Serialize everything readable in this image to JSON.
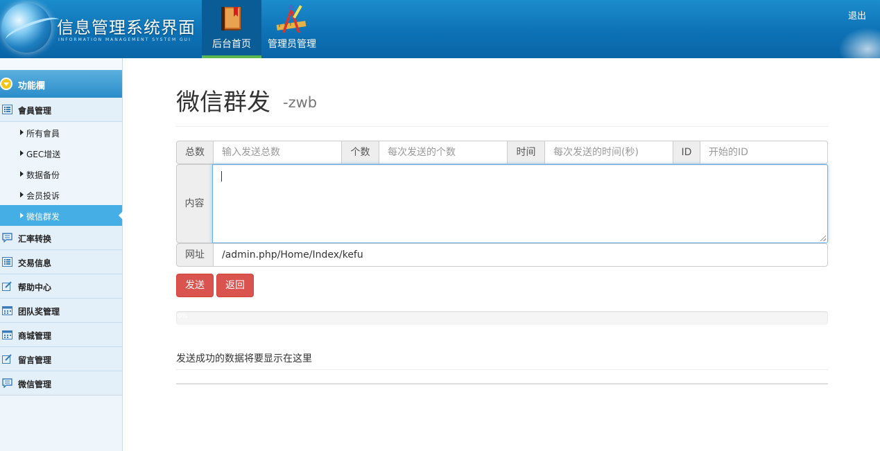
{
  "header": {
    "title": "信息管理系统界面",
    "subtitle": "INFORMATION MANAGEMENT SYSTEM GUI",
    "nav": [
      {
        "label": "后台首页",
        "icon": "book-icon"
      },
      {
        "label": "管理员管理",
        "icon": "tools-icon"
      }
    ],
    "logout": "退出"
  },
  "sidebar": {
    "heading": "功能欄",
    "groups": [
      {
        "label": "會員管理",
        "icon": "list-icon"
      },
      {
        "label": "汇率转换",
        "icon": "chat-icon"
      },
      {
        "label": "交易信息",
        "icon": "list-icon"
      },
      {
        "label": "帮助中心",
        "icon": "edit-icon"
      },
      {
        "label": "团队奖管理",
        "icon": "calendar-icon"
      },
      {
        "label": "商城管理",
        "icon": "calendar-icon"
      },
      {
        "label": "留言管理",
        "icon": "edit-icon"
      },
      {
        "label": "微信管理",
        "icon": "chat-icon"
      }
    ],
    "sub_items": [
      {
        "label": "所有會員"
      },
      {
        "label": "GEC增送"
      },
      {
        "label": "数据备份"
      },
      {
        "label": "会员投诉"
      },
      {
        "label": "微信群发",
        "active": true
      }
    ]
  },
  "main": {
    "title": "微信群发",
    "subtitle": "-zwb",
    "fields": {
      "total": {
        "label": "总数",
        "placeholder": "输入发送总数"
      },
      "count": {
        "label": "个数",
        "placeholder": "每次发送的个数"
      },
      "time": {
        "label": "时间",
        "placeholder": "每次发送的时间(秒)"
      },
      "id": {
        "label": "ID",
        "placeholder": "开始的ID"
      },
      "content": {
        "label": "内容",
        "value": ""
      },
      "url": {
        "label": "网址",
        "value": "/admin.php/Home/Index/kefu"
      }
    },
    "buttons": {
      "send": "发送",
      "back": "返回"
    },
    "progress": {
      "percent": 0,
      "text": "0%"
    },
    "result_text": "发送成功的数据将要显示在这里"
  },
  "colors": {
    "header": "#0d72b6",
    "sidebar_active": "#45aee5",
    "button_danger": "#d9534f"
  }
}
